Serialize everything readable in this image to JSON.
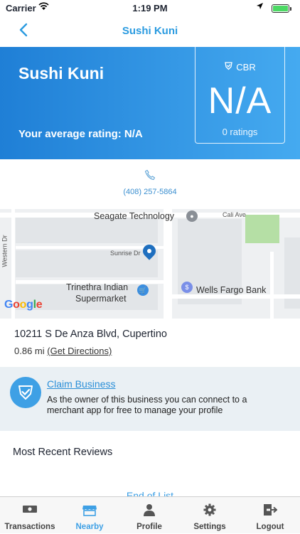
{
  "status_bar": {
    "carrier": "Carrier",
    "time": "1:19 PM"
  },
  "nav": {
    "title": "Sushi Kuni",
    "back_icon": "chevron-left-icon"
  },
  "hero": {
    "name": "Sushi Kuni",
    "average_rating_label": "Your average rating: N/A",
    "cbr_label": "CBR",
    "cbr_value": "N/A",
    "ratings_count": "0 ratings"
  },
  "contact": {
    "phone": "(408) 257-5864",
    "phone_icon": "phone-icon"
  },
  "map": {
    "labels": {
      "seagate": "Seagate Technology",
      "cali": "Cali Ave",
      "sunrise": "Sunrise Dr",
      "western": "Western Dr",
      "trinethra_1": "Trinethra Indian",
      "trinethra_2": "Supermarket",
      "wells": "Wells Fargo Bank"
    },
    "google": "Google"
  },
  "location": {
    "address": "10211 S De Anza Blvd, Cupertino",
    "distance": "0.86 mi",
    "directions": "(Get Directions)"
  },
  "claim": {
    "title": "Claim Business",
    "text": "As the owner of this business you can connect to a merchant app for free to manage your profile"
  },
  "reviews": {
    "title": "Most Recent Reviews",
    "end": "End of List"
  },
  "tabs": [
    {
      "label": "Transactions",
      "icon": "cash-icon",
      "active": false
    },
    {
      "label": "Nearby",
      "icon": "store-icon",
      "active": true
    },
    {
      "label": "Profile",
      "icon": "person-icon",
      "active": false
    },
    {
      "label": "Settings",
      "icon": "gear-icon",
      "active": false
    },
    {
      "label": "Logout",
      "icon": "logout-icon",
      "active": false
    }
  ],
  "colors": {
    "accent": "#3ea0e5",
    "hero_start": "#1f7fd6",
    "hero_end": "#45aaf0"
  }
}
